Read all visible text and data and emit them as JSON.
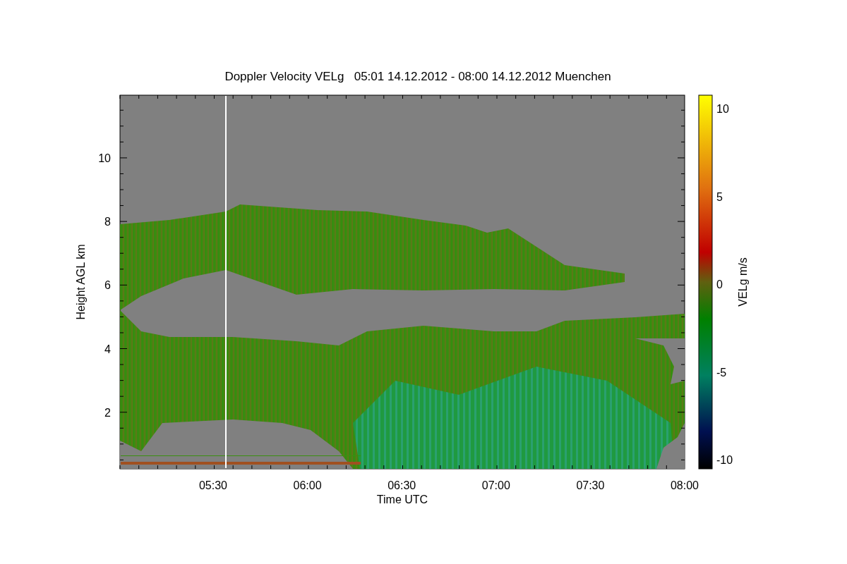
{
  "title": "Doppler Velocity VELg   05:01 14.12.2012 - 08:00 14.12.2012 Muenchen",
  "y_axis": {
    "label": "Height AGL km",
    "ticks": [
      "10",
      "8",
      "6",
      "4",
      "2"
    ]
  },
  "x_axis": {
    "label": "Time UTC",
    "ticks": [
      "05:30",
      "06:00",
      "06:30",
      "07:00",
      "07:30",
      "08:00"
    ]
  },
  "colorbar": {
    "label": "VELg m/s",
    "ticks": [
      "10",
      "5",
      "0",
      "-5",
      "-10"
    ]
  }
}
